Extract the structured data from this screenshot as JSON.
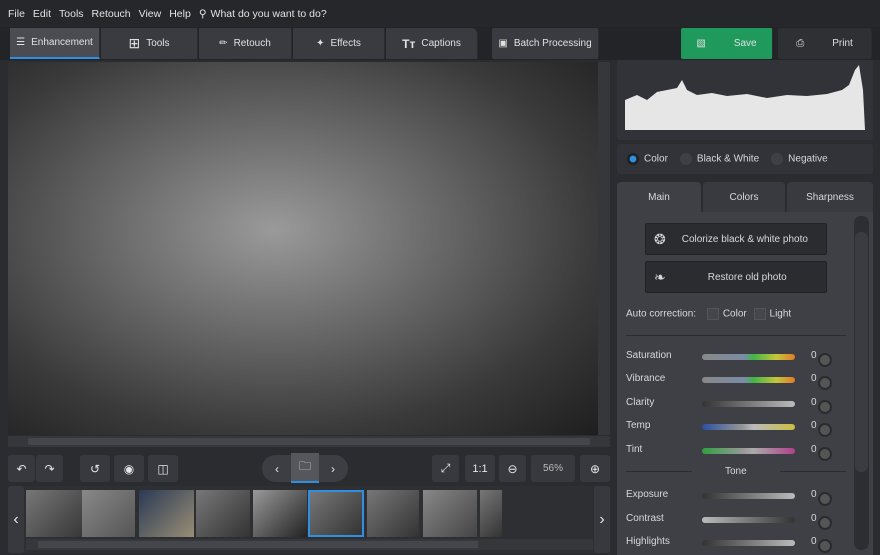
{
  "menu": {
    "items": [
      "File",
      "Edit",
      "Tools",
      "Retouch",
      "View",
      "Help"
    ],
    "search_placeholder": "What do you want to do?"
  },
  "tabs": [
    {
      "label": "Enhancement",
      "icon": "sliders-icon"
    },
    {
      "label": "Tools",
      "icon": "crop-icon"
    },
    {
      "label": "Retouch",
      "icon": "brush-icon"
    },
    {
      "label": "Effects",
      "icon": "magic-wand-icon"
    },
    {
      "label": "Captions",
      "icon": "text-icon"
    }
  ],
  "batch_label": "Batch Processing",
  "save_label": "Save",
  "print_label": "Print",
  "colors": {
    "accent": "#2f8fe0",
    "save": "#1f9a5c"
  },
  "mode": {
    "options": [
      "Color",
      "Black & White",
      "Negative"
    ],
    "selected": "Color"
  },
  "panel_tabs": [
    "Main",
    "Colors",
    "Sharpness"
  ],
  "colorize_label": "Colorize black & white photo",
  "restore_label": "Restore old photo",
  "auto": {
    "label": "Auto correction:",
    "color": "Color",
    "light": "Light"
  },
  "sliders": [
    {
      "label": "Saturation",
      "value": "0"
    },
    {
      "label": "Vibrance",
      "value": "0"
    },
    {
      "label": "Clarity",
      "value": "0"
    },
    {
      "label": "Temp",
      "value": "0"
    },
    {
      "label": "Tint",
      "value": "0"
    }
  ],
  "tone_label": "Tone",
  "tone_sliders": [
    {
      "label": "Exposure",
      "value": "0"
    },
    {
      "label": "Contrast",
      "value": "0"
    },
    {
      "label": "Highlights",
      "value": "0"
    }
  ],
  "zoom": {
    "one_to_one": "1:1",
    "level": "56%"
  }
}
